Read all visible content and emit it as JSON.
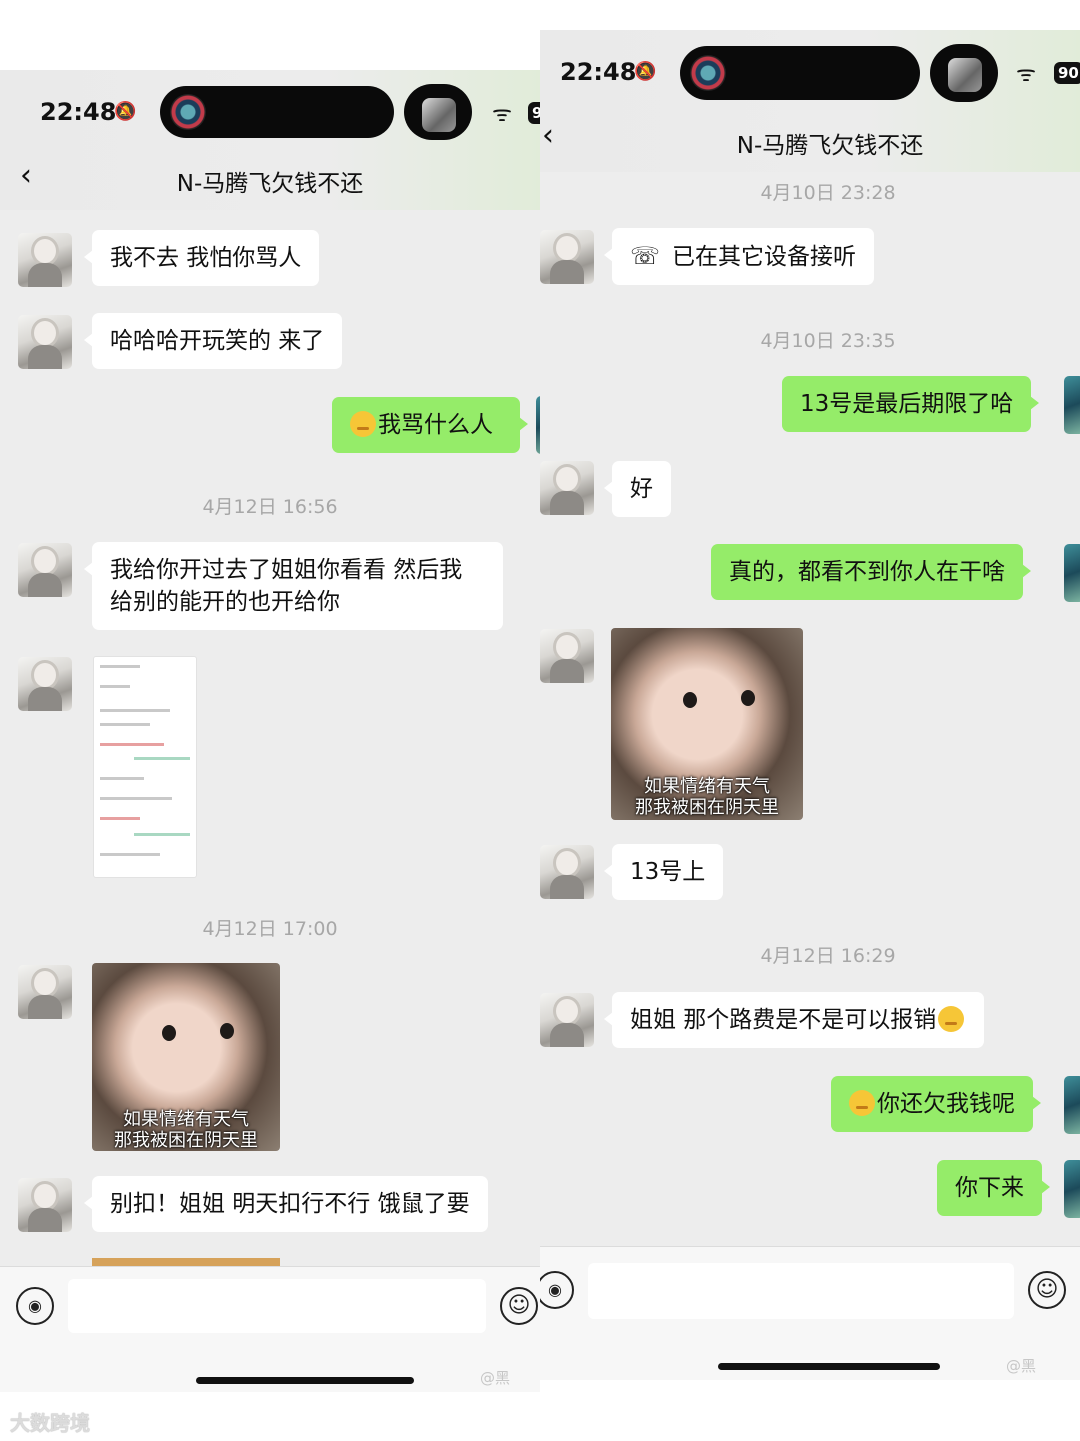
{
  "status_bar": {
    "time": "22:48",
    "battery": "90"
  },
  "chat": {
    "title": "N-马腾飞欠钱不还"
  },
  "left": {
    "messages": [
      {
        "from": "them",
        "text": "我不去 我怕你骂人"
      },
      {
        "from": "them",
        "text": "哈哈哈开玩笑的 来了"
      },
      {
        "from": "me",
        "text": "我骂什么人"
      },
      {
        "timestamp": "4月12日 16:56"
      },
      {
        "from": "them",
        "text": "我给你开过去了姐姐你看看 然后我给别的能开的也开给你"
      },
      {
        "from": "them",
        "type": "screenshot"
      },
      {
        "timestamp": "4月12日 17:00"
      },
      {
        "from": "them",
        "type": "sticker",
        "caption": [
          "如果情绪有天气",
          "那我被困在阴天里"
        ]
      },
      {
        "from": "them",
        "text": "别扣！姐姐 明天扣行不行 饿鼠了要"
      }
    ]
  },
  "right": {
    "messages": [
      {
        "timestamp": "4月10日 23:28"
      },
      {
        "from": "them",
        "type": "call",
        "text": "已在其它设备接听"
      },
      {
        "timestamp": "4月10日 23:35"
      },
      {
        "from": "me",
        "text": "13号是最后期限了哈"
      },
      {
        "from": "them",
        "text": "好"
      },
      {
        "from": "me",
        "text": "真的，都看不到你人在干啥"
      },
      {
        "from": "them",
        "type": "sticker",
        "caption": [
          "如果情绪有天气",
          "那我被困在阴天里"
        ]
      },
      {
        "from": "them",
        "text": "13号上"
      },
      {
        "timestamp": "4月12日 16:29"
      },
      {
        "from": "them",
        "text": "姐姐 那个路费是不是可以报销"
      },
      {
        "from": "me",
        "text": "你还欠我钱呢"
      },
      {
        "from": "me",
        "text": "你下来"
      }
    ]
  },
  "icons": {
    "back": "chevron-left-icon",
    "voice": "voice-input-icon",
    "emoji": "emoji-icon",
    "mute": "bell-slash-icon",
    "wifi": "wifi-icon"
  },
  "watermark": {
    "weibo": "@黑",
    "brand": "大数跨境"
  },
  "colors": {
    "my_bubble": "#95ec69",
    "their_bubble": "#ffffff",
    "background": "#ededed"
  }
}
